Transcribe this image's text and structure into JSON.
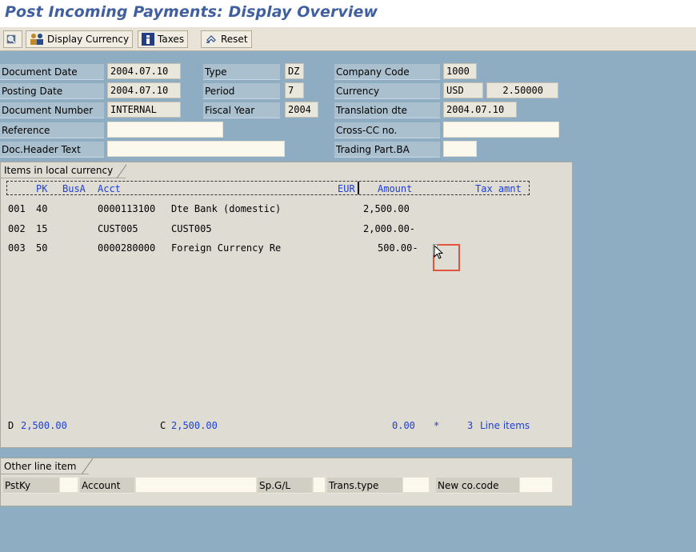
{
  "title": "Post Incoming Payments: Display Overview",
  "toolbar": {
    "display_currency": "Display Currency",
    "taxes": "Taxes",
    "reset": "Reset"
  },
  "header": {
    "doc_date_label": "Document Date",
    "doc_date": "2004.07.10",
    "type_label": "Type",
    "type": "DZ",
    "company_code_label": "Company Code",
    "company_code": "1000",
    "posting_date_label": "Posting Date",
    "posting_date": "2004.07.10",
    "period_label": "Period",
    "period": "7",
    "currency_label": "Currency",
    "currency": "USD",
    "rate": "2.50000",
    "doc_number_label": "Document Number",
    "doc_number": "INTERNAL",
    "fiscal_year_label": "Fiscal Year",
    "fiscal_year": "2004",
    "translation_label": "Translation dte",
    "translation": "2004.07.10",
    "reference_label": "Reference",
    "cross_cc_label": "Cross-CC no.",
    "doc_header_label": "Doc.Header Text",
    "trading_part_label": "Trading Part.BA"
  },
  "items": {
    "tab": "Items in local currency",
    "col_pk": "PK",
    "col_busa": "BusA",
    "col_acct": "Acct",
    "col_cur": "EUR",
    "col_amount": "Amount",
    "col_tax": "Tax amnt",
    "rows": [
      {
        "no": "001",
        "pk": "40",
        "acct": "0000113100",
        "desc": "Dte Bank (domestic)",
        "amount": "2,500.00"
      },
      {
        "no": "002",
        "pk": "15",
        "acct": "CUST005",
        "desc": "CUST005",
        "amount": "2,000.00-"
      },
      {
        "no": "003",
        "pk": "50",
        "acct": "0000280000",
        "desc": "Foreign Currency Re",
        "amount": "500.00-"
      }
    ],
    "debit_label": "D",
    "debit": "2,500.00",
    "credit_label": "C",
    "credit": "2,500.00",
    "balance": "0.00",
    "star": "*",
    "line_count": "3",
    "line_items_label": "Line items"
  },
  "other": {
    "tab": "Other line item",
    "pstky_label": "PstKy",
    "account_label": "Account",
    "spgl_label": "Sp.G/L",
    "trans_type_label": "Trans.type",
    "new_co_label": "New co.code"
  }
}
